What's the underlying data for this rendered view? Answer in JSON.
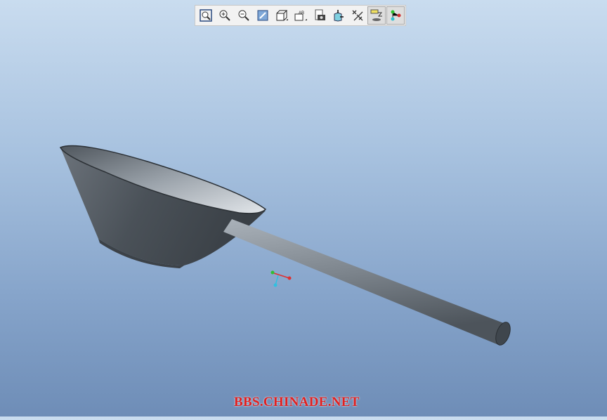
{
  "toolbar": {
    "buttons": [
      {
        "id": "refit",
        "icon": "refit-icon",
        "active": false
      },
      {
        "id": "zoom-in",
        "icon": "zoom-in-icon",
        "active": false
      },
      {
        "id": "zoom-out",
        "icon": "zoom-out-icon",
        "active": false
      },
      {
        "id": "repaint",
        "icon": "repaint-icon",
        "active": false
      },
      {
        "id": "display-style",
        "icon": "display-style-icon",
        "active": false
      },
      {
        "id": "saved-orientations",
        "icon": "saved-views-icon",
        "active": false
      },
      {
        "id": "view-manager",
        "icon": "view-manager-icon",
        "active": false
      },
      {
        "id": "spin-center",
        "icon": "spin-center-icon",
        "active": false
      },
      {
        "id": "datum-display",
        "icon": "datum-display-icon",
        "active": false
      },
      {
        "id": "annotation-display",
        "icon": "annotation-display-icon",
        "active": true
      },
      {
        "id": "csys-display",
        "icon": "csys-display-icon",
        "active": true
      }
    ]
  },
  "watermark": "BBS.CHINADE.NET",
  "colors": {
    "bg_top": "#c9dcef",
    "bg_bottom": "#6e8db7",
    "model": "#5c636b",
    "csys_x": "#e03030",
    "csys_y": "#30c030",
    "csys_z": "#30c0e0"
  }
}
